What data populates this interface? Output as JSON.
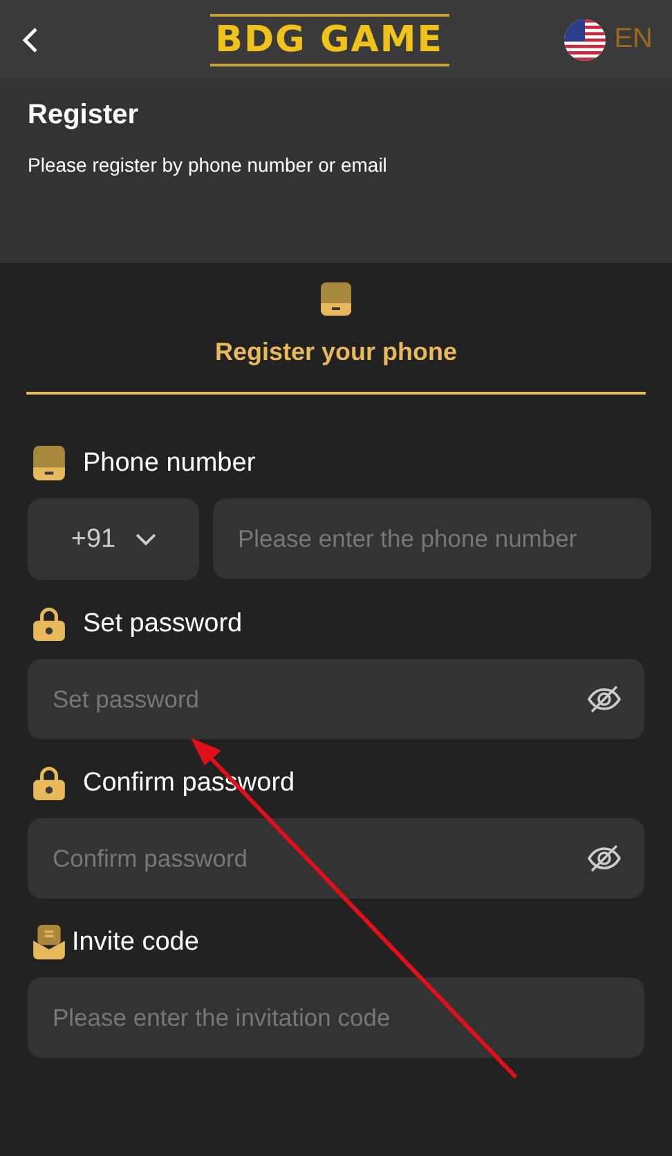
{
  "header": {
    "logo": "BDG GAME",
    "language": "EN"
  },
  "intro": {
    "title": "Register",
    "subtitle": "Please register by phone number or email"
  },
  "tabs": [
    {
      "label": "Register your phone",
      "selected": true
    }
  ],
  "fields": [
    {
      "kind": "phone",
      "label": "Phone number",
      "code": "+91",
      "placeholder": "Please enter the phone number"
    },
    {
      "kind": "password",
      "label": "Set password",
      "placeholder": "Set password"
    },
    {
      "kind": "password",
      "label": "Confirm password",
      "placeholder": "Confirm password"
    },
    {
      "kind": "text",
      "label": "Invite code",
      "placeholder": "Please enter the invitation code"
    }
  ],
  "annotation": {
    "kind": "arrow"
  }
}
